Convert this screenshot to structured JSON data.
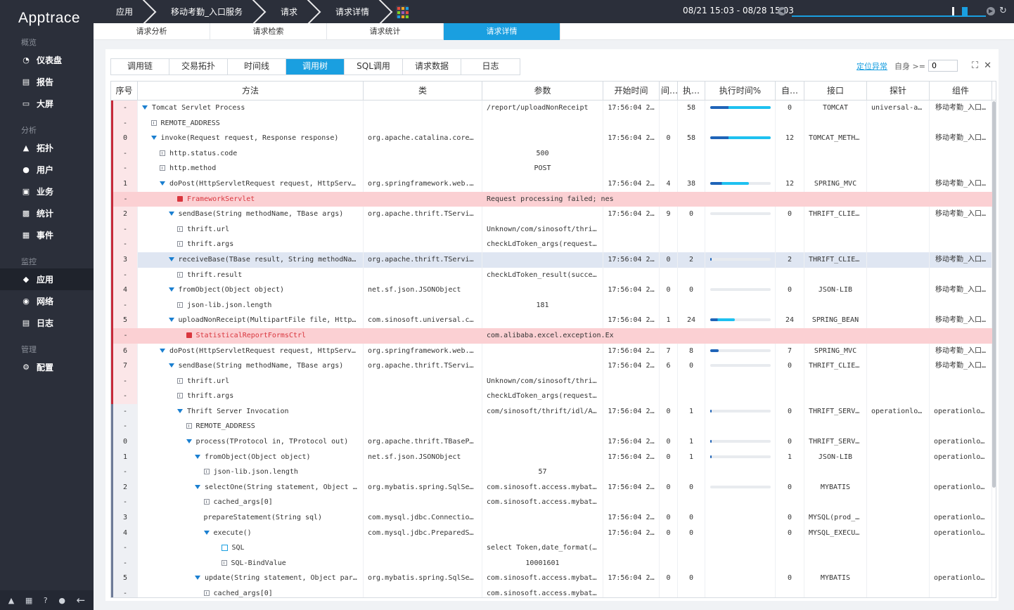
{
  "app": {
    "logo": "Apptrace"
  },
  "sidebar": {
    "sections": [
      {
        "title": "概览",
        "items": [
          {
            "label": "仪表盘",
            "icon": "dashboard-icon"
          },
          {
            "label": "报告",
            "icon": "report-icon"
          },
          {
            "label": "大屏",
            "icon": "monitor-icon"
          }
        ]
      },
      {
        "title": "分析",
        "items": [
          {
            "label": "拓扑",
            "icon": "topology-icon"
          },
          {
            "label": "用户",
            "icon": "user-icon"
          },
          {
            "label": "业务",
            "icon": "briefcase-icon"
          },
          {
            "label": "统计",
            "icon": "stats-icon"
          },
          {
            "label": "事件",
            "icon": "event-icon"
          }
        ]
      },
      {
        "title": "监控",
        "items": [
          {
            "label": "应用",
            "icon": "app-icon",
            "active": true
          },
          {
            "label": "网络",
            "icon": "network-icon"
          },
          {
            "label": "日志",
            "icon": "log-icon"
          }
        ]
      },
      {
        "title": "管理",
        "items": [
          {
            "label": "配置",
            "icon": "gear-icon"
          }
        ]
      }
    ]
  },
  "breadcrumb": [
    "应用",
    "移动考勤_入口服务",
    "请求",
    "请求详情"
  ],
  "time_range": "08/21 15:03 - 08/28 15:03",
  "subtabs": [
    "请求分析",
    "请求检索",
    "请求统计",
    "请求详情"
  ],
  "subtab_active": 3,
  "view_tabs": [
    "调用链",
    "交易拓扑",
    "时间线",
    "调用树",
    "SQL调用",
    "请求数据",
    "日志"
  ],
  "view_tab_active": 3,
  "tools": {
    "locate_label": "定位异常",
    "self_label": "自身 >=",
    "self_value": "0"
  },
  "columns": [
    "序号",
    "方法",
    "类",
    "参数",
    "开始时间",
    "间…",
    "执…",
    "执行时间%",
    "自…",
    "接口",
    "探针",
    "组件"
  ],
  "rows": [
    {
      "idx": "-",
      "indent": 0,
      "kind": "node",
      "method": "Tomcat Servlet Process",
      "cls": "",
      "param": "/report/uploadNonReceipt",
      "start": "17:56:04 2…",
      "gap": "",
      "exec": "58",
      "pct": 100,
      "self": "0",
      "iface": "TOMCAT",
      "probe": "universal-ac…",
      "comp": "移动考勤_入口…"
    },
    {
      "idx": "-",
      "indent": 1,
      "kind": "field",
      "method": "REMOTE_ADDRESS",
      "cls": "",
      "param": "",
      "start": "",
      "gap": "",
      "exec": "",
      "pct": null,
      "self": "",
      "iface": "",
      "probe": "",
      "comp": ""
    },
    {
      "idx": "0",
      "indent": 1,
      "kind": "node",
      "method": "invoke(Request request, Response response)",
      "cls": "org.apache.catalina.core.S…",
      "param": "",
      "start": "17:56:04 2…",
      "gap": "0",
      "exec": "58",
      "pct": 100,
      "self": "12",
      "iface": "TOMCAT_METHOD",
      "probe": "",
      "comp": "移动考勤_入口…"
    },
    {
      "idx": "-",
      "indent": 2,
      "kind": "field",
      "method": "http.status.code",
      "cls": "",
      "param": "500",
      "start": "",
      "gap": "",
      "exec": "",
      "pct": null,
      "self": "",
      "iface": "",
      "probe": "",
      "comp": ""
    },
    {
      "idx": "-",
      "indent": 2,
      "kind": "field",
      "method": "http.method",
      "cls": "",
      "param": "POST",
      "start": "",
      "gap": "",
      "exec": "",
      "pct": null,
      "self": "",
      "iface": "",
      "probe": "",
      "comp": ""
    },
    {
      "idx": "1",
      "indent": 2,
      "kind": "node",
      "method": "doPost(HttpServletRequest request, HttpServletResponse response)",
      "cls": "org.springframework.web.se…",
      "param": "",
      "start": "17:56:04 2…",
      "gap": "4",
      "exec": "38",
      "pct": 65,
      "self": "12",
      "iface": "SPRING_MVC",
      "probe": "",
      "comp": "移动考勤_入口…"
    },
    {
      "idx": "-",
      "indent": 4,
      "kind": "error",
      "method": "FrameworkServlet",
      "cls": "",
      "param": "Request processing failed; nes",
      "start": "",
      "gap": "",
      "exec": "",
      "pct": null,
      "self": "",
      "iface": "",
      "probe": "",
      "comp": ""
    },
    {
      "idx": "2",
      "indent": 3,
      "kind": "node",
      "method": "sendBase(String methodName, TBase args)",
      "cls": "org.apache.thrift.TService…",
      "param": "",
      "start": "17:56:04 2…",
      "gap": "9",
      "exec": "0",
      "pct": 0,
      "self": "0",
      "iface": "THRIFT_CLIEN…",
      "probe": "",
      "comp": "移动考勤_入口…"
    },
    {
      "idx": "-",
      "indent": 4,
      "kind": "field",
      "method": "thrift.url",
      "cls": "",
      "param": "Unknown/com/sinosoft/thrift/id",
      "start": "",
      "gap": "",
      "exec": "",
      "pct": null,
      "self": "",
      "iface": "",
      "probe": "",
      "comp": ""
    },
    {
      "idx": "-",
      "indent": 4,
      "kind": "field",
      "method": "thrift.args",
      "cls": "",
      "param": "checkLdToken_args(requestStr:{",
      "start": "",
      "gap": "",
      "exec": "",
      "pct": null,
      "self": "",
      "iface": "",
      "probe": "",
      "comp": ""
    },
    {
      "idx": "3",
      "indent": 3,
      "kind": "node",
      "sel": true,
      "method": "receiveBase(TBase result, String methodName)",
      "cls": "org.apache.thrift.TService…",
      "param": "",
      "start": "17:56:04 2…",
      "gap": "0",
      "exec": "2",
      "pct": 3,
      "self": "2",
      "iface": "THRIFT_CLIEN…",
      "probe": "",
      "comp": "移动考勤_入口…"
    },
    {
      "idx": "-",
      "indent": 4,
      "kind": "field",
      "method": "thrift.result",
      "cls": "",
      "param": "checkLdToken_result(success:{\"",
      "start": "",
      "gap": "",
      "exec": "",
      "pct": null,
      "self": "",
      "iface": "",
      "probe": "",
      "comp": ""
    },
    {
      "idx": "4",
      "indent": 3,
      "kind": "node",
      "method": "fromObject(Object object)",
      "cls": "net.sf.json.JSONObject",
      "param": "",
      "start": "17:56:04 2…",
      "gap": "0",
      "exec": "0",
      "pct": 0,
      "self": "0",
      "iface": "JSON-LIB",
      "probe": "",
      "comp": "移动考勤_入口…"
    },
    {
      "idx": "-",
      "indent": 4,
      "kind": "field",
      "method": "json-lib.json.length",
      "cls": "",
      "param": "181",
      "start": "",
      "gap": "",
      "exec": "",
      "pct": null,
      "self": "",
      "iface": "",
      "probe": "",
      "comp": ""
    },
    {
      "idx": "5",
      "indent": 3,
      "kind": "node",
      "method": "uploadNonReceipt(MultipartFile file, HttpServletRequest request)",
      "cls": "com.sinosoft.universal.con…",
      "param": "",
      "start": "17:56:04 2…",
      "gap": "1",
      "exec": "24",
      "pct": 41,
      "self": "24",
      "iface": "SPRING_BEAN",
      "probe": "",
      "comp": "移动考勤_入口…"
    },
    {
      "idx": "-",
      "indent": 5,
      "kind": "error",
      "method": "StatisticalReportFormsCtrl",
      "cls": "",
      "param": "com.alibaba.excel.exception.Ex",
      "start": "",
      "gap": "",
      "exec": "",
      "pct": null,
      "self": "",
      "iface": "",
      "probe": "",
      "comp": ""
    },
    {
      "idx": "6",
      "indent": 2,
      "kind": "node",
      "method": "doPost(HttpServletRequest request, HttpServletResponse response)",
      "cls": "org.springframework.web.se…",
      "param": "",
      "start": "17:56:04 2…",
      "gap": "7",
      "exec": "8",
      "pct": 14,
      "self": "7",
      "iface": "SPRING_MVC",
      "probe": "",
      "comp": "移动考勤_入口…"
    },
    {
      "idx": "7",
      "indent": 3,
      "kind": "node",
      "method": "sendBase(String methodName, TBase args)",
      "cls": "org.apache.thrift.TService…",
      "param": "",
      "start": "17:56:04 2…",
      "gap": "6",
      "exec": "0",
      "pct": 0,
      "self": "0",
      "iface": "THRIFT_CLIEN…",
      "probe": "",
      "comp": "移动考勤_入口…"
    },
    {
      "idx": "-",
      "indent": 4,
      "kind": "field",
      "method": "thrift.url",
      "cls": "",
      "param": "Unknown/com/sinosoft/thrift/id",
      "start": "",
      "gap": "",
      "exec": "",
      "pct": null,
      "self": "",
      "iface": "",
      "probe": "",
      "comp": ""
    },
    {
      "idx": "-",
      "indent": 4,
      "kind": "field",
      "method": "thrift.args",
      "cls": "",
      "param": "checkLdToken_args(requestStr:{",
      "start": "",
      "gap": "",
      "exec": "",
      "pct": null,
      "self": "",
      "iface": "",
      "probe": "",
      "comp": ""
    },
    {
      "idx": "-",
      "indent": 4,
      "kind": "node",
      "inner": true,
      "method": "Thrift Server Invocation",
      "cls": "",
      "param": "com/sinosoft/thrift/idl/AMS_Op",
      "start": "17:56:04 2…",
      "gap": "0",
      "exec": "1",
      "pct": 2,
      "self": "0",
      "iface": "THRIFT_SERVER",
      "probe": "operationlog…",
      "comp": "operationlog…"
    },
    {
      "idx": "-",
      "indent": 5,
      "kind": "field",
      "inner": true,
      "method": "REMOTE_ADDRESS",
      "cls": "",
      "param": "",
      "start": "",
      "gap": "",
      "exec": "",
      "pct": null,
      "self": "",
      "iface": "",
      "probe": "",
      "comp": ""
    },
    {
      "idx": "0",
      "indent": 5,
      "kind": "node",
      "inner": true,
      "method": "process(TProtocol in, TProtocol out)",
      "cls": "org.apache.thrift.TBasePro…",
      "param": "",
      "start": "17:56:04 2…",
      "gap": "0",
      "exec": "1",
      "pct": 2,
      "self": "0",
      "iface": "THRIFT_SERVE…",
      "probe": "",
      "comp": "operationlog…"
    },
    {
      "idx": "1",
      "indent": 6,
      "kind": "node",
      "inner": true,
      "method": "fromObject(Object object)",
      "cls": "net.sf.json.JSONObject",
      "param": "",
      "start": "17:56:04 2…",
      "gap": "0",
      "exec": "1",
      "pct": 2,
      "self": "1",
      "iface": "JSON-LIB",
      "probe": "",
      "comp": "operationlog…"
    },
    {
      "idx": "-",
      "indent": 7,
      "kind": "field",
      "inner": true,
      "method": "json-lib.json.length",
      "cls": "",
      "param": "57",
      "start": "",
      "gap": "",
      "exec": "",
      "pct": null,
      "self": "",
      "iface": "",
      "probe": "",
      "comp": ""
    },
    {
      "idx": "2",
      "indent": 6,
      "kind": "node",
      "inner": true,
      "method": "selectOne(String statement, Object parameter)",
      "cls": "org.mybatis.spring.SqlSess…",
      "param": "com.sinosoft.access.mybatis.da",
      "start": "17:56:04 2…",
      "gap": "0",
      "exec": "0",
      "pct": 0,
      "self": "0",
      "iface": "MYBATIS",
      "probe": "",
      "comp": "operationlog…"
    },
    {
      "idx": "-",
      "indent": 7,
      "kind": "field",
      "inner": true,
      "method": "cached_args[0]",
      "cls": "",
      "param": "com.sinosoft.access.mybatis.da",
      "start": "",
      "gap": "",
      "exec": "",
      "pct": null,
      "self": "",
      "iface": "",
      "probe": "",
      "comp": ""
    },
    {
      "idx": "3",
      "indent": 7,
      "kind": "leaf",
      "inner": true,
      "method": "prepareStatement(String sql)",
      "cls": "com.mysql.jdbc.ConnectionI…",
      "param": "",
      "start": "17:56:04 2…",
      "gap": "0",
      "exec": "0",
      "pct": null,
      "self": "0",
      "iface": "MYSQL(prod_a…",
      "probe": "",
      "comp": "operationlog…"
    },
    {
      "idx": "4",
      "indent": 7,
      "kind": "node",
      "inner": true,
      "method": "execute()",
      "cls": "com.mysql.jdbc.PreparedSta…",
      "param": "",
      "start": "17:56:04 2…",
      "gap": "0",
      "exec": "0",
      "pct": null,
      "self": "0",
      "iface": "MYSQL_EXECUT…",
      "probe": "",
      "comp": "operationlog…"
    },
    {
      "idx": "-",
      "indent": 9,
      "kind": "sql",
      "inner": true,
      "method": "SQL",
      "cls": "",
      "param": "select Token,date_format(effec",
      "start": "",
      "gap": "",
      "exec": "",
      "pct": null,
      "self": "",
      "iface": "",
      "probe": "",
      "comp": ""
    },
    {
      "idx": "-",
      "indent": 9,
      "kind": "field",
      "inner": true,
      "method": "SQL-BindValue",
      "cls": "",
      "param": "10001601",
      "start": "",
      "gap": "",
      "exec": "",
      "pct": null,
      "self": "",
      "iface": "",
      "probe": "",
      "comp": ""
    },
    {
      "idx": "5",
      "indent": 6,
      "kind": "node",
      "inner": true,
      "method": "update(String statement, Object parameter)",
      "cls": "org.mybatis.spring.SqlSess…",
      "param": "com.sinosoft.access.mybatis.da",
      "start": "17:56:04 2…",
      "gap": "0",
      "exec": "0",
      "pct": null,
      "self": "0",
      "iface": "MYBATIS",
      "probe": "",
      "comp": "operationlog…"
    },
    {
      "idx": "-",
      "indent": 7,
      "kind": "field",
      "inner": true,
      "method": "cached_args[0]",
      "cls": "",
      "param": "com.sinosoft.access.mybatis.da",
      "start": "",
      "gap": "",
      "exec": "",
      "pct": null,
      "self": "",
      "iface": "",
      "probe": "",
      "comp": ""
    }
  ],
  "colors": {
    "accent": "#1a9fe0",
    "sidebar": "#2b2f3a",
    "error_row": "#fbd0d3",
    "error_text": "#d9363e"
  }
}
